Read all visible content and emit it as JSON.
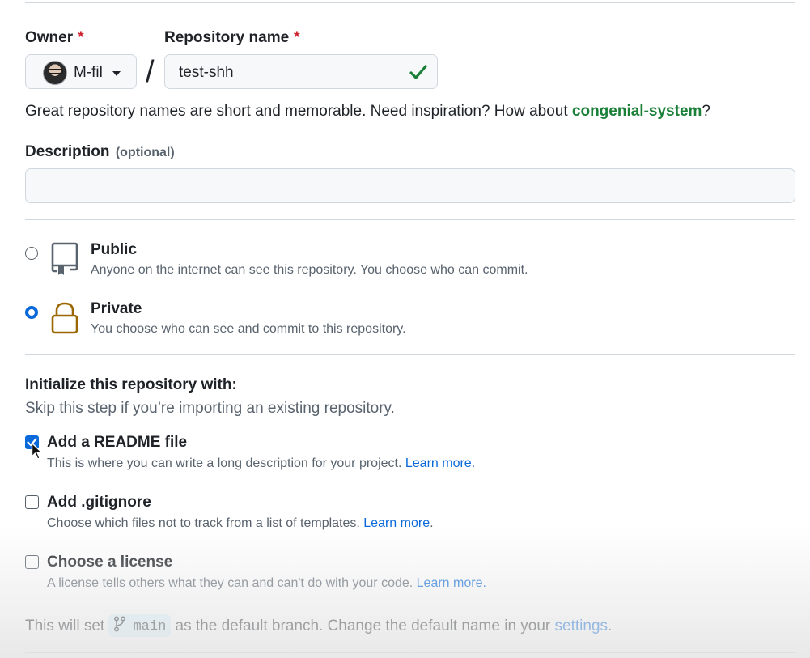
{
  "owner": {
    "label": "Owner",
    "required_mark": "*",
    "value": "M-fil"
  },
  "separator": "/",
  "repo_name": {
    "label": "Repository name",
    "required_mark": "*",
    "value": "test-shh"
  },
  "name_hint": {
    "text": "Great repository names are short and memorable. Need inspiration? How about ",
    "suggestion": "congenial-system",
    "suffix": "?"
  },
  "description": {
    "label": "Description",
    "optional": "(optional)",
    "value": ""
  },
  "visibility": {
    "public": {
      "title": "Public",
      "desc": "Anyone on the internet can see this repository. You choose who can commit.",
      "selected": false
    },
    "private": {
      "title": "Private",
      "desc": "You choose who can see and commit to this repository.",
      "selected": true
    }
  },
  "initialize": {
    "title": "Initialize this repository with:",
    "subtitle": "Skip this step if you’re importing an existing repository.",
    "readme": {
      "title": "Add a README file",
      "desc": "This is where you can write a long description for your project. ",
      "link": "Learn more.",
      "checked": true
    },
    "gitignore": {
      "title": "Add .gitignore",
      "desc": "Choose which files not to track from a list of templates. ",
      "link": "Learn more",
      "after": ".",
      "checked": false
    },
    "license": {
      "title": "Choose a license",
      "desc": "A license tells others what they can and can't do with your code. ",
      "link": "Learn more.",
      "checked": false
    }
  },
  "branch_note": {
    "before": "This will set ",
    "branch": "main",
    "after": " as the default branch. Change the default name in your ",
    "link": "settings",
    "end": "."
  },
  "colors": {
    "accent": "#0969da",
    "success": "#1a7f37",
    "danger": "#cf222e",
    "private_icon": "#9a6700"
  },
  "icons": {
    "valid": "check-icon",
    "public": "repo-icon",
    "private": "lock-icon",
    "branch": "git-branch-icon",
    "owner_menu": "caret-down-icon"
  }
}
